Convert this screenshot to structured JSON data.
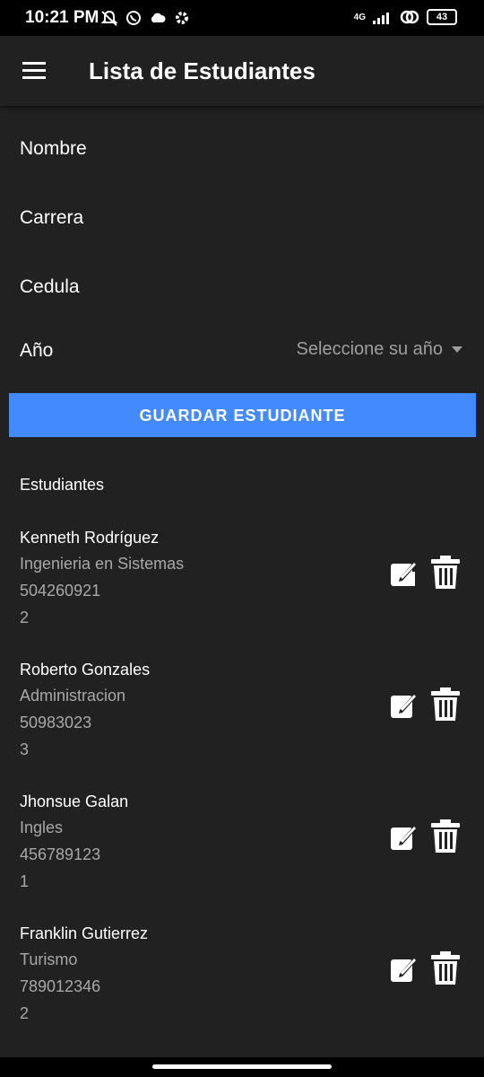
{
  "status_bar": {
    "time": "10:21 PM",
    "network": "4G",
    "battery": "43"
  },
  "app_bar": {
    "title": "Lista de Estudiantes"
  },
  "form": {
    "nombre_label": "Nombre",
    "carrera_label": "Carrera",
    "cedula_label": "Cedula",
    "anio_label": "Año",
    "anio_placeholder": "Seleccione su año",
    "save_button": "GUARDAR ESTUDIANTE"
  },
  "list": {
    "title": "Estudiantes",
    "students": [
      {
        "name": "Kenneth Rodríguez",
        "career": "Ingenieria en Sistemas",
        "id": "504260921",
        "year": "2"
      },
      {
        "name": "Roberto Gonzales",
        "career": "Administracion",
        "id": "50983023",
        "year": "3"
      },
      {
        "name": "Jhonsue Galan",
        "career": "Ingles",
        "id": "456789123",
        "year": "1"
      },
      {
        "name": "Franklin Gutierrez",
        "career": "Turismo",
        "id": "789012346",
        "year": "2"
      }
    ]
  },
  "icons": {
    "menu": "menu-icon",
    "edit": "edit-icon",
    "delete": "trash-icon"
  }
}
